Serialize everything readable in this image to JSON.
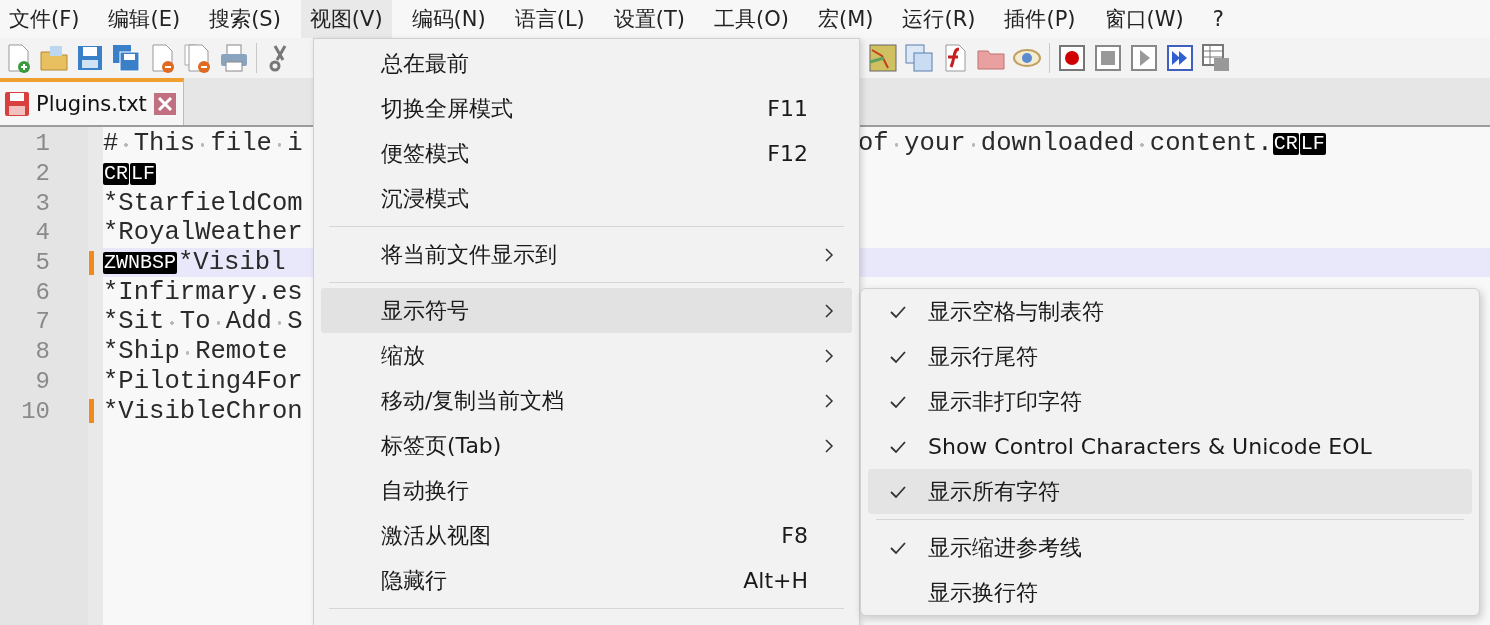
{
  "menubar": [
    {
      "label": "文件(F)",
      "selected": false
    },
    {
      "label": "编辑(E)",
      "selected": false
    },
    {
      "label": "搜索(S)",
      "selected": false
    },
    {
      "label": "视图(V)",
      "selected": true
    },
    {
      "label": "编码(N)",
      "selected": false
    },
    {
      "label": "语言(L)",
      "selected": false
    },
    {
      "label": "设置(T)",
      "selected": false
    },
    {
      "label": "工具(O)",
      "selected": false
    },
    {
      "label": "宏(M)",
      "selected": false
    },
    {
      "label": "运行(R)",
      "selected": false
    },
    {
      "label": "插件(P)",
      "selected": false
    },
    {
      "label": "窗口(W)",
      "selected": false
    },
    {
      "label": "?",
      "selected": false
    }
  ],
  "tabs": [
    {
      "label": "Plugins.txt",
      "selected": true
    }
  ],
  "editor": {
    "lines": [
      {
        "number": "1",
        "changed": false,
        "active": false,
        "segments": [
          {
            "kind": "text",
            "text": "# This file i"
          }
        ],
        "tail": [
          {
            "kind": "text",
            "text": "of your downloaded content."
          },
          {
            "kind": "symbol",
            "text": "CR"
          },
          {
            "kind": "symbol",
            "text": "LF"
          }
        ]
      },
      {
        "number": "2",
        "changed": false,
        "active": false,
        "segments": [
          {
            "kind": "symbol",
            "text": "CR"
          },
          {
            "kind": "symbol",
            "text": "LF"
          }
        ]
      },
      {
        "number": "3",
        "changed": false,
        "active": false,
        "segments": [
          {
            "kind": "text",
            "text": "*StarfieldCom"
          }
        ]
      },
      {
        "number": "4",
        "changed": false,
        "active": false,
        "segments": [
          {
            "kind": "text",
            "text": "*RoyalWeather"
          }
        ]
      },
      {
        "number": "5",
        "changed": true,
        "active": true,
        "segments": [
          {
            "kind": "symbol",
            "text": "ZWNBSP"
          },
          {
            "kind": "text",
            "text": "*Visibl"
          }
        ]
      },
      {
        "number": "6",
        "changed": false,
        "active": false,
        "segments": [
          {
            "kind": "text",
            "text": "*Infirmary.es"
          }
        ]
      },
      {
        "number": "7",
        "changed": false,
        "active": false,
        "segments": [
          {
            "kind": "text",
            "text": "*Sit To Add S"
          }
        ]
      },
      {
        "number": "8",
        "changed": false,
        "active": false,
        "segments": [
          {
            "kind": "text",
            "text": "*Ship Remote"
          }
        ]
      },
      {
        "number": "9",
        "changed": false,
        "active": false,
        "segments": [
          {
            "kind": "text",
            "text": "*Piloting4For"
          }
        ]
      },
      {
        "number": "10",
        "changed": true,
        "active": false,
        "segments": [
          {
            "kind": "text",
            "text": "*VisibleChron"
          }
        ]
      }
    ]
  },
  "view_menu": {
    "items": [
      {
        "kind": "item",
        "label": "总在最前",
        "selected": false
      },
      {
        "kind": "item",
        "label": "切换全屏模式",
        "shortcut": "F11",
        "selected": false
      },
      {
        "kind": "item",
        "label": "便签模式",
        "shortcut": "F12",
        "selected": false
      },
      {
        "kind": "item",
        "label": "沉浸模式",
        "selected": false
      },
      {
        "kind": "separator"
      },
      {
        "kind": "submenu",
        "label": "将当前文件显示到",
        "selected": false
      },
      {
        "kind": "separator"
      },
      {
        "kind": "submenu",
        "label": "显示符号",
        "selected": true
      },
      {
        "kind": "submenu",
        "label": "缩放",
        "selected": false
      },
      {
        "kind": "submenu",
        "label": "移动/复制当前文档",
        "selected": false
      },
      {
        "kind": "submenu",
        "label": "标签页(Tab)",
        "selected": false
      },
      {
        "kind": "item",
        "label": "自动换行",
        "selected": false
      },
      {
        "kind": "item",
        "label": "激活从视图",
        "shortcut": "F8",
        "selected": false
      },
      {
        "kind": "item",
        "label": "隐藏行",
        "shortcut": "Alt+H",
        "selected": false
      },
      {
        "kind": "separator"
      }
    ]
  },
  "symbols_menu": {
    "items": [
      {
        "kind": "item",
        "label": "显示空格与制表符",
        "checked": true,
        "selected": false
      },
      {
        "kind": "item",
        "label": "显示行尾符",
        "checked": true,
        "selected": false
      },
      {
        "kind": "item",
        "label": "显示非打印字符",
        "checked": true,
        "selected": false
      },
      {
        "kind": "item",
        "label": "Show Control Characters & Unicode EOL",
        "checked": true,
        "selected": false
      },
      {
        "kind": "item",
        "label": "显示所有字符",
        "checked": true,
        "selected": true
      },
      {
        "kind": "separator"
      },
      {
        "kind": "item",
        "label": "显示缩进参考线",
        "checked": true,
        "selected": false
      },
      {
        "kind": "item",
        "label": "显示换行符",
        "checked": false,
        "selected": false
      }
    ]
  }
}
